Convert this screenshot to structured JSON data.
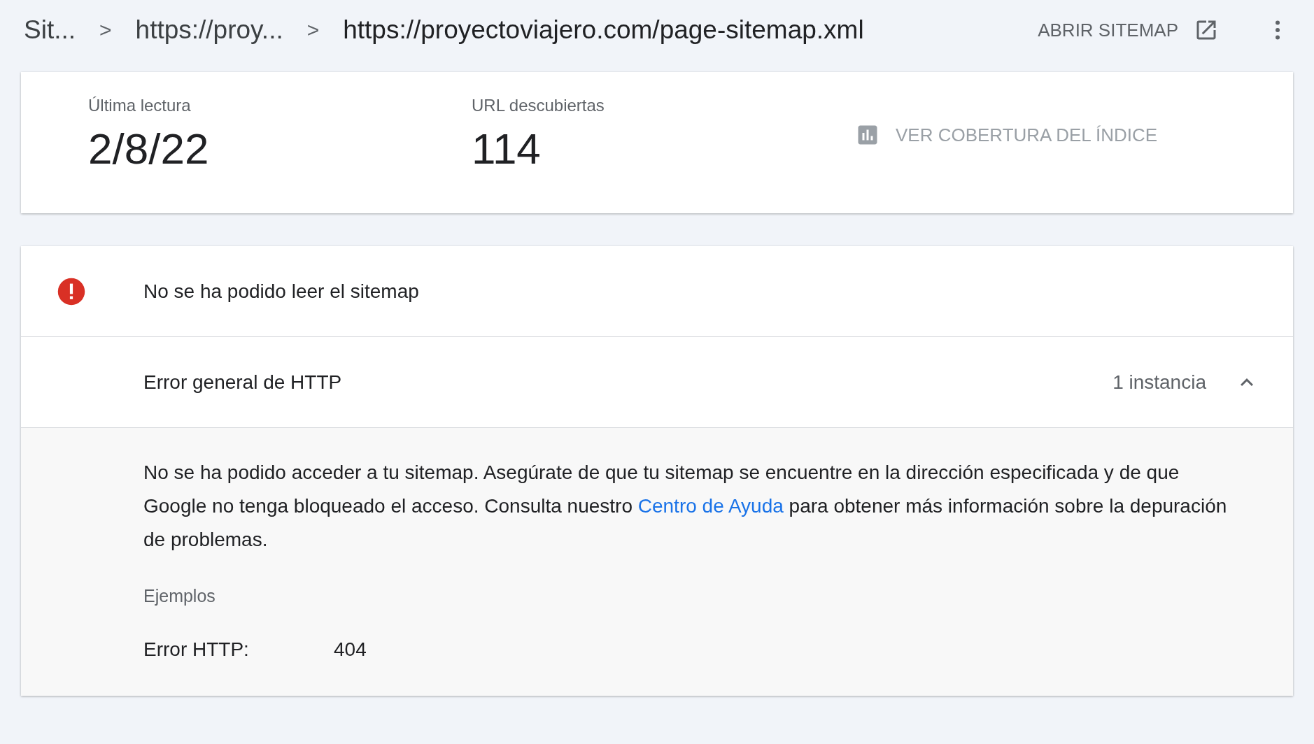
{
  "breadcrumbs": [
    {
      "label": "Sit..."
    },
    {
      "label": "https://proy..."
    },
    {
      "label": "https://proyectoviajero.com/page-sitemap.xml"
    }
  ],
  "breadcrumb_separator": ">",
  "open_sitemap": {
    "label": "ABRIR SITEMAP"
  },
  "stats": [
    {
      "label": "Última lectura",
      "value": "2/8/22"
    },
    {
      "label": "URL descubiertas",
      "value": "114"
    }
  ],
  "coverage_link": {
    "label": "VER COBERTURA DEL ÍNDICE",
    "disabled": true
  },
  "status": {
    "kind": "error",
    "title": "No se ha podido leer el sitemap"
  },
  "issue": {
    "title": "Error general de HTTP",
    "count": "1 instancia",
    "expanded": true,
    "description": {
      "before": "No se ha podido acceder a tu sitemap. Asegúrate de que tu sitemap se encuentre en la dirección especificada y de que Google no tenga bloqueado el acceso. Consulta nuestro ",
      "link": "Centro de Ayuda",
      "after": " para obtener más información sobre la depuración de problemas."
    },
    "examples_heading": "Ejemplos",
    "examples": [
      {
        "label": "Error HTTP:",
        "value": "404"
      }
    ]
  }
}
